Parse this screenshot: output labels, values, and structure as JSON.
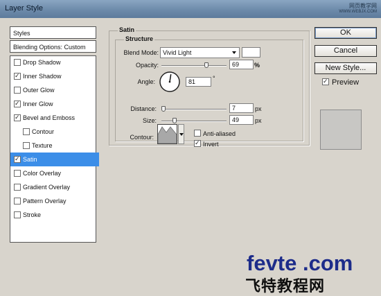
{
  "window": {
    "title": "Layer Style"
  },
  "watermark": {
    "top": "网页教学网",
    "url": "WWW.WEBJX.COM"
  },
  "sidebar": {
    "styles_label": "Styles",
    "blending_label": "Blending Options: Custom",
    "items": [
      {
        "label": "Drop Shadow",
        "checked": false,
        "indent": false,
        "active": false
      },
      {
        "label": "Inner Shadow",
        "checked": true,
        "indent": false,
        "active": false
      },
      {
        "label": "Outer Glow",
        "checked": false,
        "indent": false,
        "active": false
      },
      {
        "label": "Inner Glow",
        "checked": true,
        "indent": false,
        "active": false
      },
      {
        "label": "Bevel and Emboss",
        "checked": true,
        "indent": false,
        "active": false
      },
      {
        "label": "Contour",
        "checked": false,
        "indent": true,
        "active": false
      },
      {
        "label": "Texture",
        "checked": false,
        "indent": true,
        "active": false
      },
      {
        "label": "Satin",
        "checked": true,
        "indent": false,
        "active": true
      },
      {
        "label": "Color Overlay",
        "checked": false,
        "indent": false,
        "active": false
      },
      {
        "label": "Gradient Overlay",
        "checked": false,
        "indent": false,
        "active": false
      },
      {
        "label": "Pattern Overlay",
        "checked": false,
        "indent": false,
        "active": false
      },
      {
        "label": "Stroke",
        "checked": false,
        "indent": false,
        "active": false
      }
    ]
  },
  "satin": {
    "group_title": "Satin",
    "structure_title": "Structure",
    "blend_mode_label": "Blend Mode:",
    "blend_mode_value": "Vivid Light",
    "blend_color": "#ffffff",
    "opacity_label": "Opacity:",
    "opacity_value": "69",
    "opacity_unit": "%",
    "opacity_fraction": 0.69,
    "angle_label": "Angle:",
    "angle_value": "81",
    "angle_unit": "°",
    "angle_degrees": 81,
    "distance_label": "Distance:",
    "distance_value": "7",
    "distance_unit": "px",
    "distance_fraction": 0.03,
    "size_label": "Size:",
    "size_value": "49",
    "size_unit": "px",
    "size_fraction": 0.2,
    "contour_label": "Contour:",
    "anti_aliased_label": "Anti-aliased",
    "anti_aliased_checked": false,
    "invert_label": "Invert",
    "invert_checked": true
  },
  "buttons": {
    "ok": "OK",
    "cancel": "Cancel",
    "new_style": "New Style..."
  },
  "preview": {
    "label": "Preview",
    "checked": true
  },
  "brand": {
    "latin": "fevte .com",
    "chinese": "飞特教程网"
  },
  "colors": {
    "accent": "#3c8ee8",
    "brand": "#1d2c8a"
  }
}
